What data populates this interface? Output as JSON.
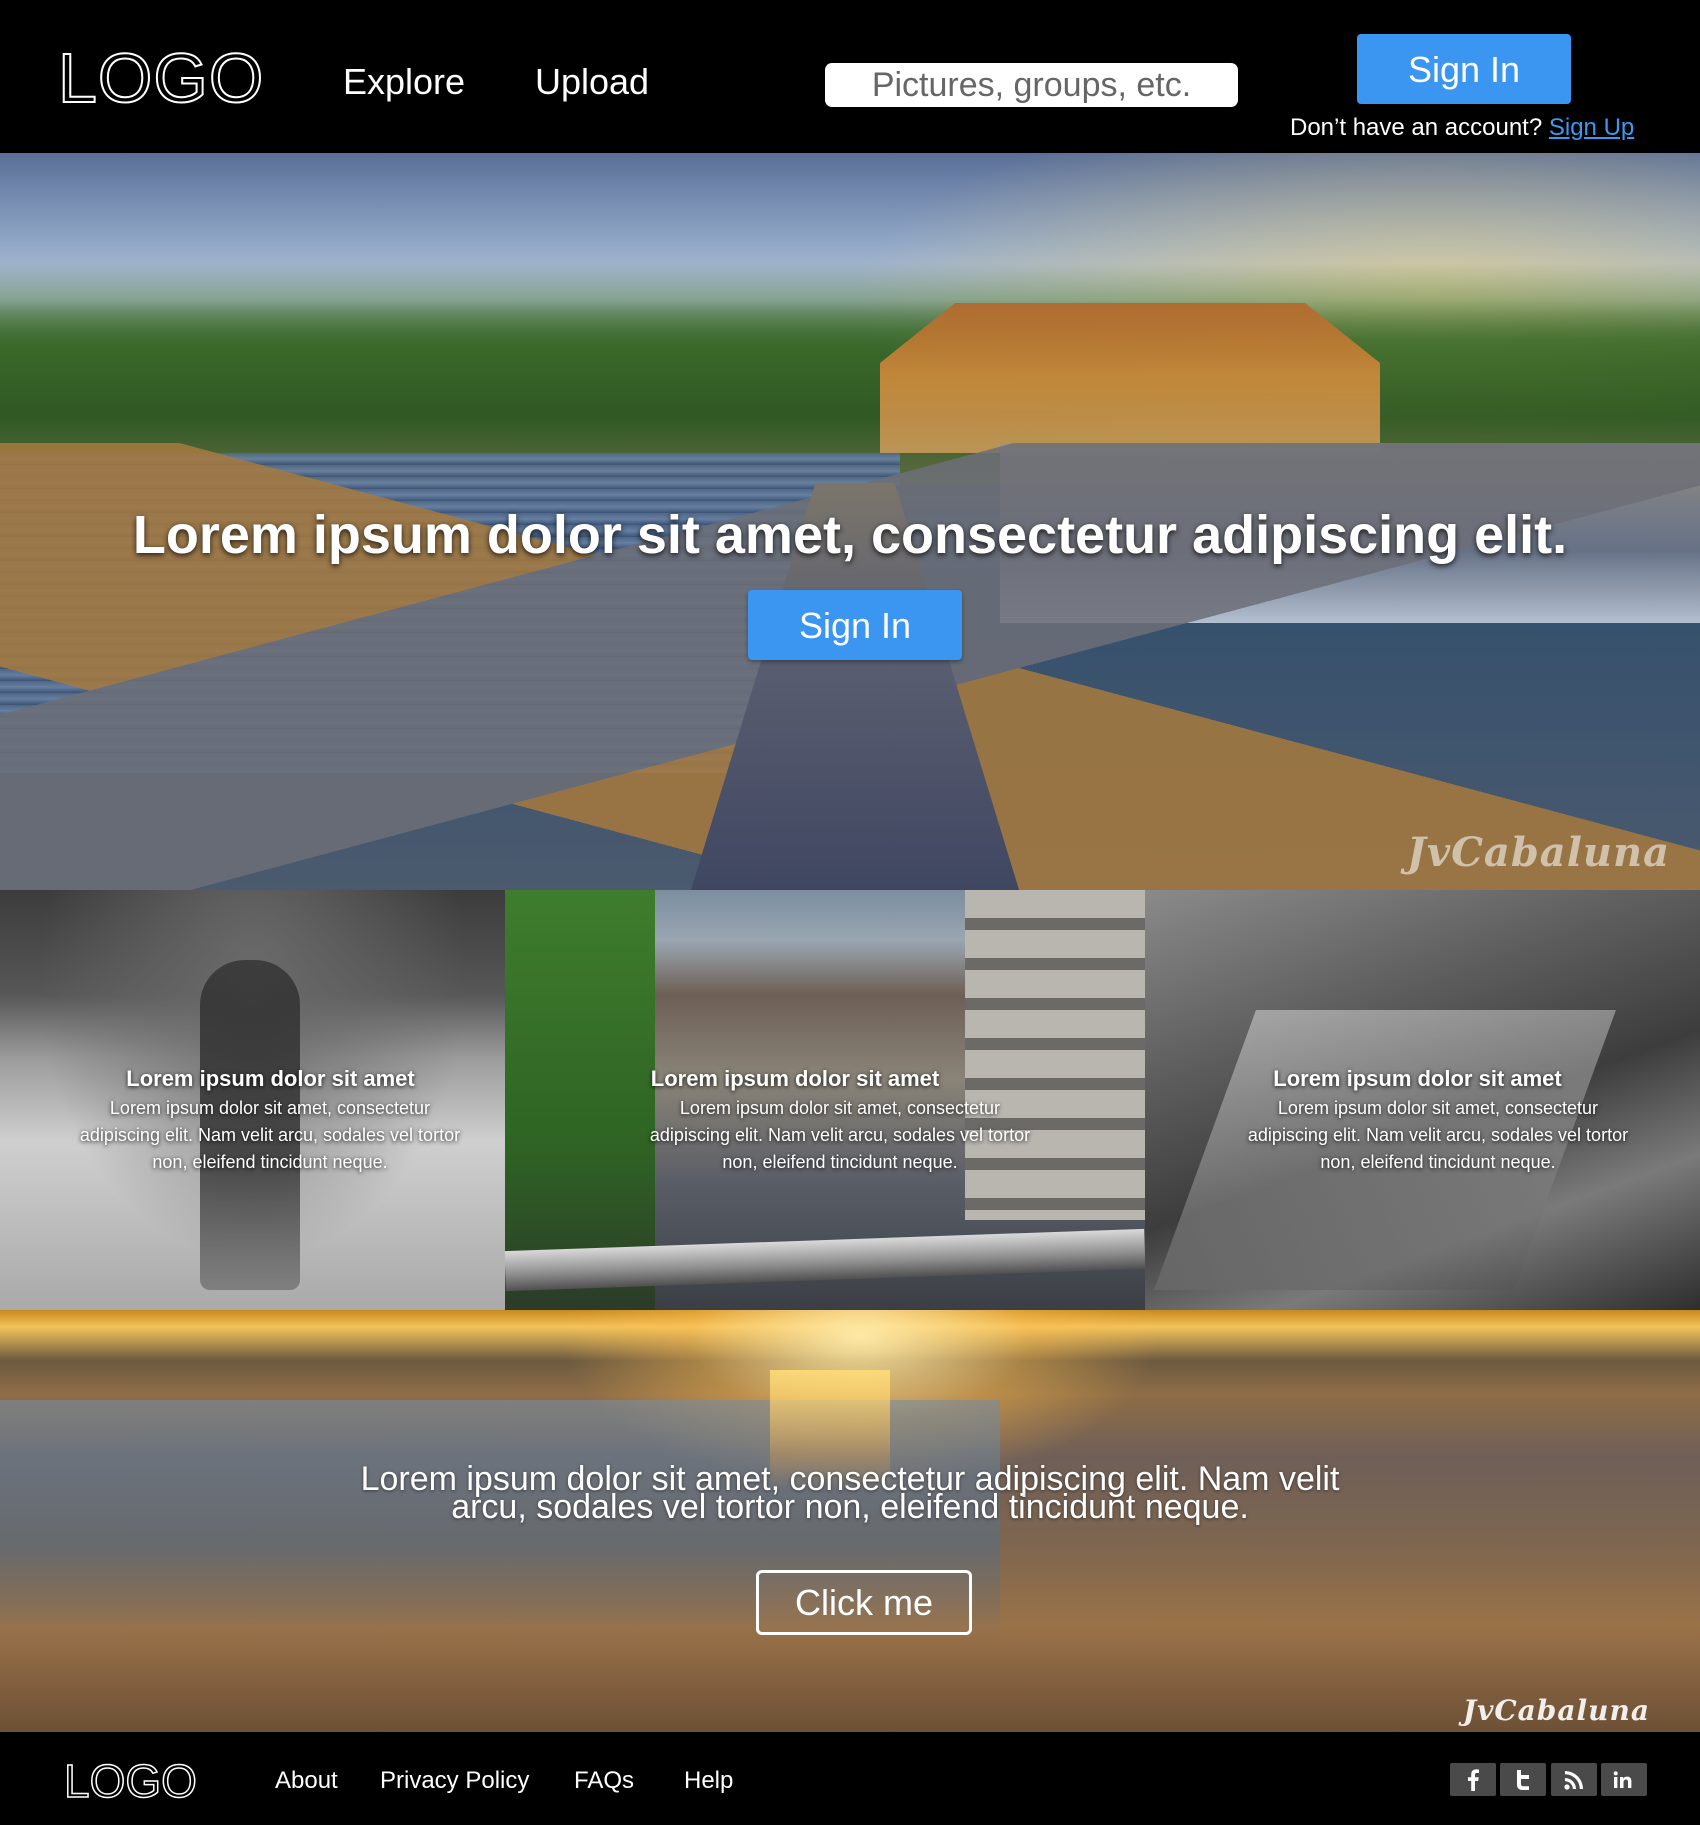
{
  "header": {
    "logo": "LOGO",
    "nav": {
      "explore": "Explore",
      "upload": "Upload"
    },
    "search": {
      "placeholder": "Pictures, groups, etc."
    },
    "sign_in": "Sign In",
    "account_prompt": "Don’t have an account?",
    "sign_up": "Sign Up"
  },
  "hero": {
    "title": "Lorem ipsum dolor sit amet, consectetur adipiscing elit.",
    "sign_in": "Sign In",
    "watermark": "JvCabaluna"
  },
  "gallery": {
    "items": [
      {
        "title": "Lorem ipsum dolor sit amet",
        "text": "Lorem ipsum dolor sit amet, consectetur adipiscing elit. Nam velit arcu, sodales vel tortor non, eleifend tincidunt neque."
      },
      {
        "title": "Lorem ipsum dolor sit amet",
        "text": "Lorem ipsum dolor sit amet, consectetur adipiscing elit. Nam velit arcu, sodales vel tortor non, eleifend tincidunt neque."
      },
      {
        "title": "Lorem ipsum dolor sit amet",
        "text": "Lorem ipsum dolor sit amet, consectetur adipiscing elit. Nam velit arcu, sodales vel tortor non, eleifend tincidunt neque."
      }
    ]
  },
  "promo": {
    "text": "Lorem ipsum dolor sit amet, consectetur adipiscing elit. Nam velit arcu, sodales vel tortor non, eleifend tincidunt neque.",
    "button": "Click me",
    "watermark": "JvCabaluna"
  },
  "footer": {
    "logo": "LOGO",
    "links": {
      "about": "About",
      "privacy": "Privacy Policy",
      "faqs": "FAQs",
      "help": "Help"
    },
    "social": [
      {
        "icon": "facebook-icon",
        "glyph": "f"
      },
      {
        "icon": "twitter-icon",
        "glyph": "t"
      },
      {
        "icon": "rss-icon",
        "glyph": ""
      },
      {
        "icon": "linkedin-icon",
        "glyph": "in"
      }
    ]
  },
  "colors": {
    "accent": "#3a96f0",
    "link": "#3a9af2",
    "header_bg": "#000000",
    "social_bg": "#4a4a4a"
  }
}
